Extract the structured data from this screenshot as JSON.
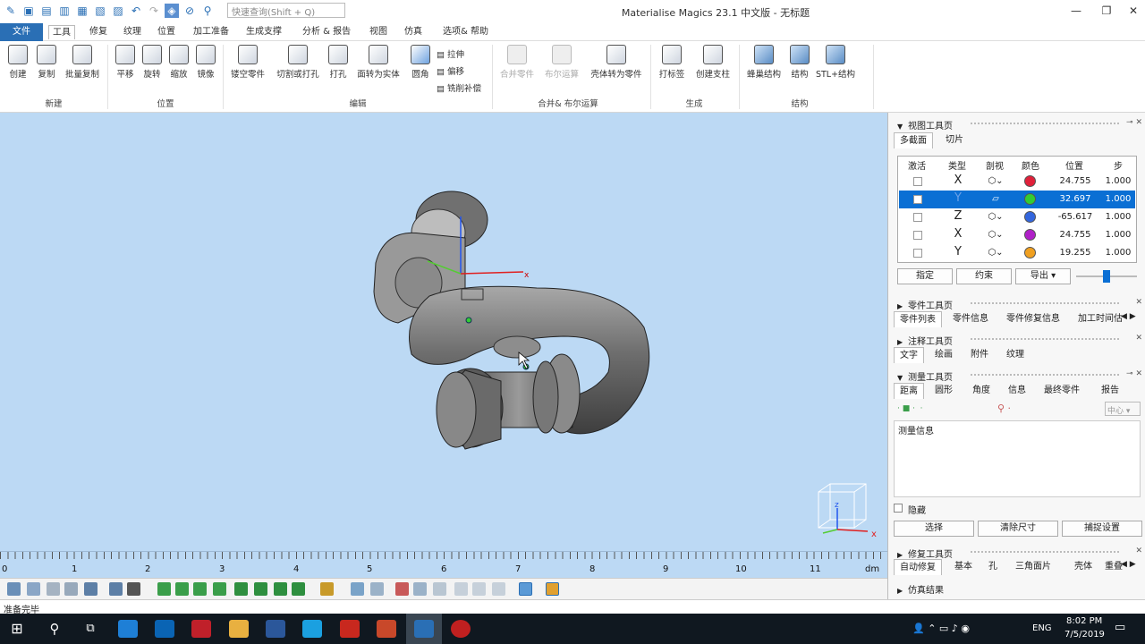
{
  "app": {
    "title": "Materialise Magics 23.1 中文版 - 无标题"
  },
  "quick_search": {
    "placeholder": "快速查询(Shift + Q)"
  },
  "menu": {
    "tabs": [
      "文件",
      "工具",
      "修复",
      "纹理",
      "位置",
      "加工准备",
      "生成支撑",
      "分析 & 报告",
      "视图",
      "仿真",
      "选项& 帮助"
    ],
    "active": "工具"
  },
  "ribbon": {
    "groups": [
      {
        "label": "新建",
        "buttons": [
          "创建",
          "复制",
          "批量复制"
        ]
      },
      {
        "label": "位置",
        "buttons": [
          "平移",
          "旋转",
          "缩放",
          "镜像"
        ]
      },
      {
        "label": "编辑",
        "buttons": [
          "镂空零件",
          "切割或打孔",
          "打孔",
          "面转为实体",
          "圆角"
        ],
        "small": [
          "拉伸",
          "偏移",
          "铣削补偿"
        ]
      },
      {
        "label": "合并& 布尔运算",
        "buttons": [
          "合并零件",
          "布尔运算",
          "壳体转为零件"
        ]
      },
      {
        "label": "生成",
        "buttons": [
          "打标签",
          "创建支柱"
        ]
      },
      {
        "label": "结构",
        "buttons": [
          "蜂巢结构",
          "结构",
          "STL+结构"
        ]
      }
    ]
  },
  "ruler": {
    "labels": [
      "0",
      "1",
      "2",
      "3",
      "4",
      "5",
      "6",
      "7",
      "8",
      "9",
      "10",
      "11"
    ],
    "unit": "dm"
  },
  "status": {
    "text": "准备完毕"
  },
  "panel": {
    "view_toolpage": {
      "title": "视图工具页",
      "tabs": [
        "多截面",
        "切片"
      ],
      "columns": [
        "激活",
        "类型",
        "剖视",
        "颜色",
        "位置",
        "步"
      ],
      "rows": [
        {
          "type": "X",
          "position": "24.755",
          "step": "1.000",
          "color": "#e0203a",
          "selected": false
        },
        {
          "type": "Y",
          "position": "32.697",
          "step": "1.000",
          "color": "#33cc33",
          "selected": true
        },
        {
          "type": "Z",
          "position": "-65.617",
          "step": "1.000",
          "color": "#3366dd",
          "selected": false
        },
        {
          "type": "X",
          "position": "24.755",
          "step": "1.000",
          "color": "#b020c8",
          "selected": false
        },
        {
          "type": "Y",
          "position": "19.255",
          "step": "1.000",
          "color": "#f0a020",
          "selected": false
        }
      ],
      "buttons": [
        "指定",
        "约束",
        "导出"
      ]
    },
    "part_toolpage": {
      "title": "零件工具页",
      "tabs": [
        "零件列表",
        "零件信息",
        "零件修复信息",
        "加工时间估"
      ]
    },
    "annotation_toolpage": {
      "title": "注释工具页",
      "tabs": [
        "文字",
        "绘画",
        "附件",
        "纹理"
      ]
    },
    "measure_toolpage": {
      "title": "测量工具页",
      "tabs": [
        "距离",
        "圆形",
        "角度",
        "信息",
        "最终零件",
        "报告"
      ],
      "center": "中心",
      "info_label": "测量信息",
      "hide_label": "隐藏",
      "buttons": [
        "选择",
        "清除尺寸",
        "捕捉设置"
      ]
    },
    "repair_toolpage": {
      "title": "修复工具页",
      "tabs": [
        "自动修复",
        "基本",
        "孔",
        "三角面片",
        "壳体",
        "重叠"
      ]
    },
    "sim_title": "仿真结果"
  },
  "taskbar": {
    "lang": "ENG",
    "time": "8:02 PM",
    "date": "7/5/2019"
  },
  "colors": {
    "viewport": "#bcd9f4",
    "accent": "#2a6fb5",
    "selection": "#0a6fd4"
  }
}
